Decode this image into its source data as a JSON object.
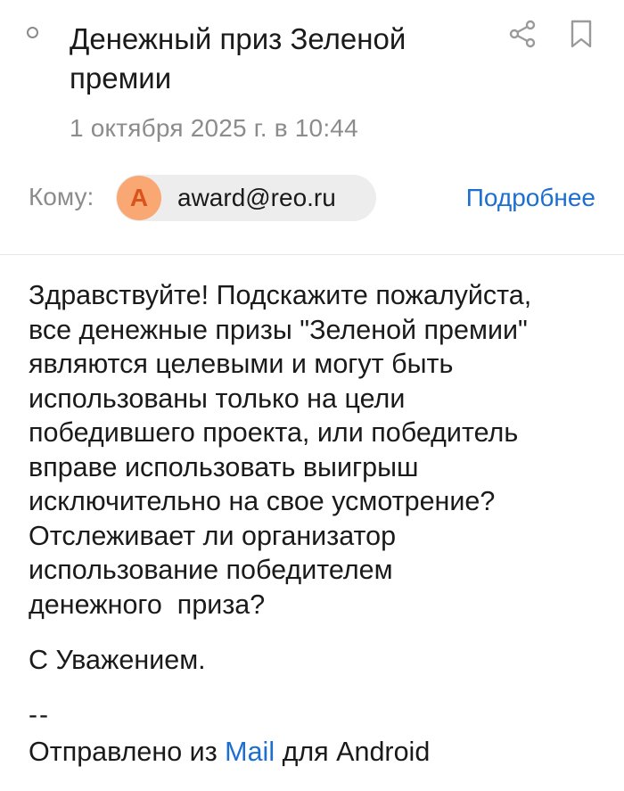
{
  "message": {
    "subject": "Денежный приз Зеленой премии",
    "date": "1 октября 2025 г. в 10:44",
    "to_label": "Кому:",
    "recipient": {
      "avatar_letter": "А",
      "email": "award@reo.ru"
    },
    "details_link": "Подробнее",
    "body": "Здравствуйте! Подскажите пожалуйста,\nвсе денежные призы \"Зеленой премии\"\nявляются целевыми и могут быть\nиспользованы только на цели\nпобедившего проекта, или победитель\nвправе использовать выигрыш\nисключительно на свое усмотрение?\nОтслеживает ли организатор\nиспользование победителем\nденежного  приза?",
    "sign_off": "С Уважением.",
    "signature_separator": "--",
    "sent_from_prefix": "Отправлено из ",
    "sent_from_app": "Mail",
    "sent_from_suffix": " для Android"
  },
  "icons": {
    "unread": "unread-dot-icon",
    "share": "share-icon",
    "bookmark": "bookmark-icon"
  },
  "colors": {
    "link": "#1c6fd1",
    "secondary_text": "#8c8c8c",
    "avatar_bg": "#f9a873",
    "avatar_fg": "#d9531c",
    "chip_bg": "#ededed"
  }
}
